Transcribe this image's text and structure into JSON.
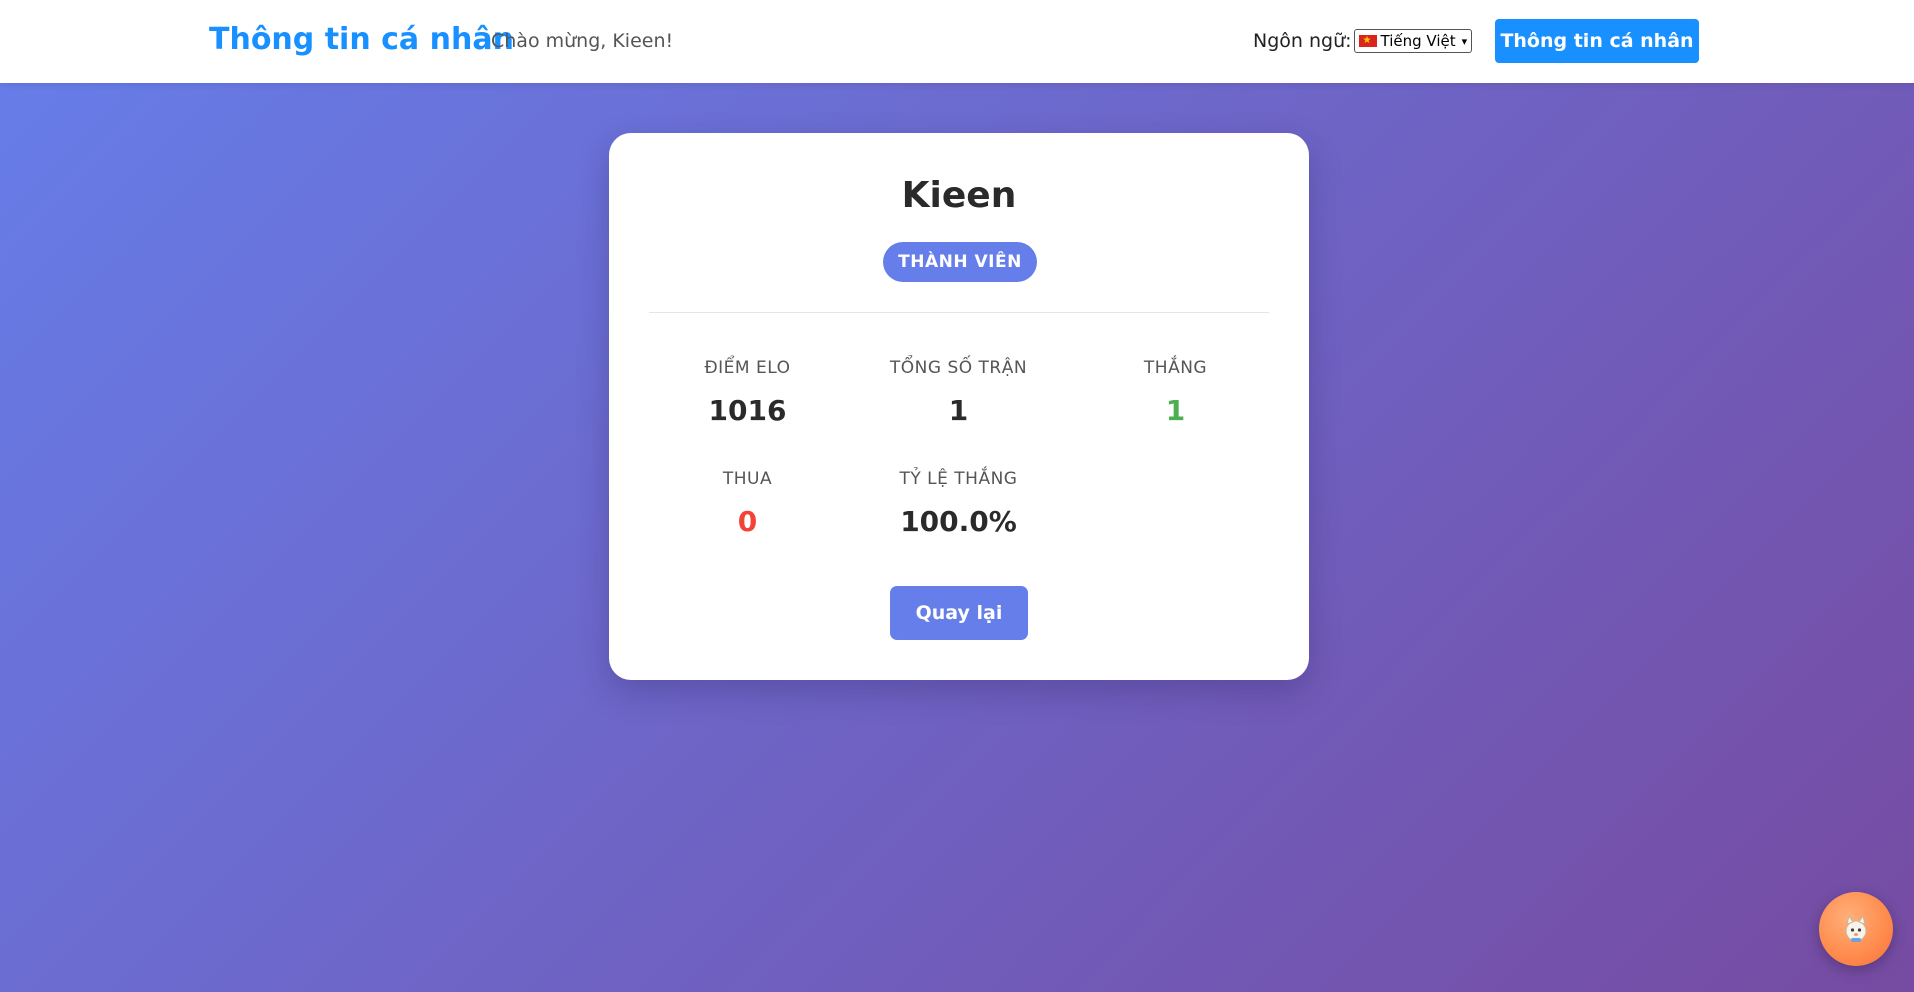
{
  "header": {
    "brand": "Thông tin cá nhân",
    "welcome": "Chào mừng, Kieen!",
    "language_label": "Ngôn ngữ:",
    "language_selected": "Tiếng Việt",
    "profile_button": "Thông tin cá nhân"
  },
  "profile": {
    "username": "Kieen",
    "role": "THÀNH VIÊN",
    "stats": {
      "elo": {
        "label": "ĐIỂM ELO",
        "value": "1016"
      },
      "total": {
        "label": "TỔNG SỐ TRẬN",
        "value": "1"
      },
      "wins": {
        "label": "THẮNG",
        "value": "1"
      },
      "losses": {
        "label": "THUA",
        "value": "0"
      },
      "winrate": {
        "label": "TỶ LỆ THẮNG",
        "value": "100.0%"
      }
    },
    "back_button": "Quay lại"
  },
  "colors": {
    "brand": "#1890ff",
    "accent": "#667eea",
    "win": "#4caf50",
    "loss": "#f44336",
    "bg_start": "#667eea",
    "bg_end": "#764ba2"
  },
  "icons": {
    "flag": "vietnam-flag-icon",
    "chat": "mascot-chat-icon"
  }
}
